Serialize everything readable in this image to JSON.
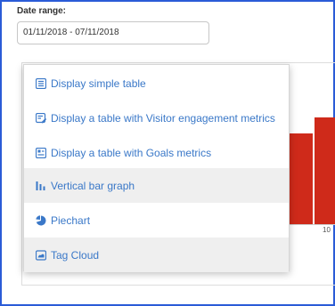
{
  "filter": {
    "date_label": "Date range:",
    "date_value": "01/11/2018 - 07/11/2018"
  },
  "menu": {
    "items": [
      {
        "label": "Display simple table",
        "icon": "table-list-icon"
      },
      {
        "label": "Display a table with Visitor engagement metrics",
        "icon": "table-edit-icon"
      },
      {
        "label": "Display a table with Goals metrics",
        "icon": "table-goal-icon"
      },
      {
        "label": "Vertical bar graph",
        "icon": "bar-chart-icon"
      },
      {
        "label": "Piechart",
        "icon": "pie-chart-icon"
      },
      {
        "label": "Tag Cloud",
        "icon": "tag-cloud-icon"
      }
    ]
  },
  "chart": {
    "bar_color": "#cf2a1a",
    "tick_label": "10"
  },
  "colors": {
    "frame_border": "#2a5bd7",
    "menu_text": "#3a78c8"
  }
}
